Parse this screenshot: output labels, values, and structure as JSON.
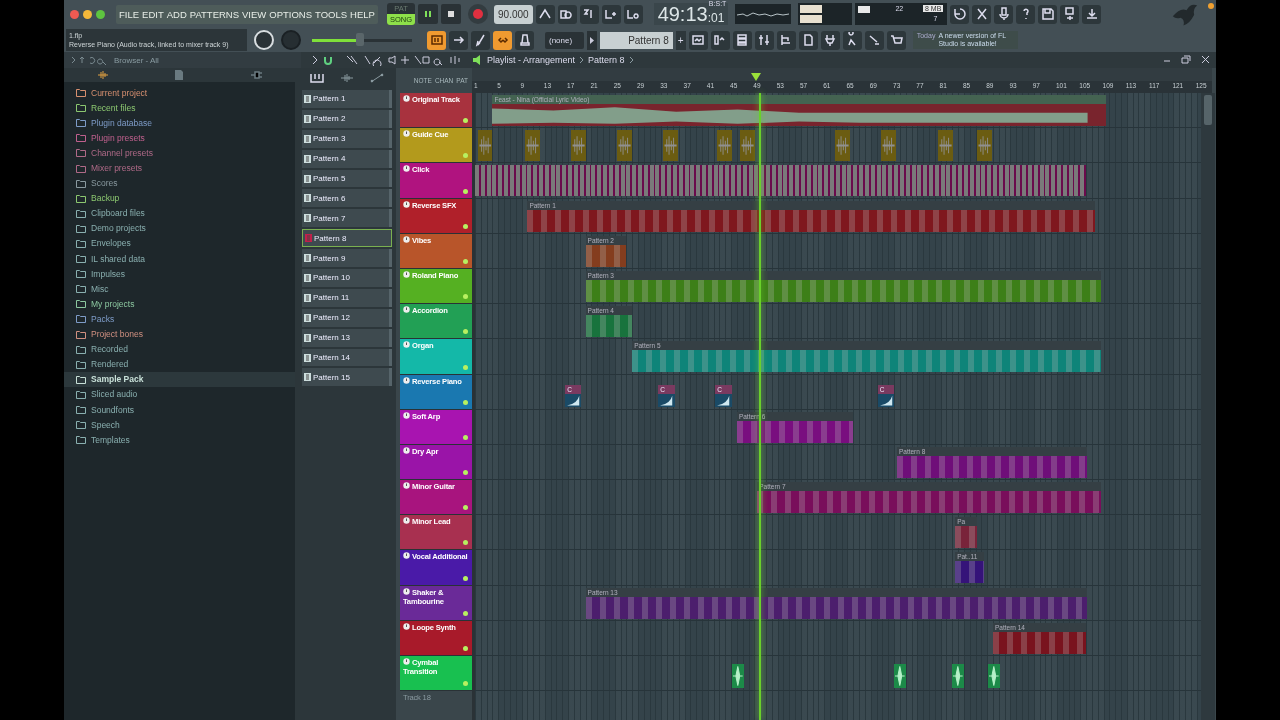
{
  "menu": [
    "FILE",
    "EDIT",
    "ADD",
    "PATTERNS",
    "VIEW",
    "OPTIONS",
    "TOOLS",
    "HELP"
  ],
  "transport": {
    "modes": [
      {
        "label": "PAT",
        "selected": false
      },
      {
        "label": "SONG",
        "selected": true
      }
    ],
    "playing": true,
    "tempo": "90.000",
    "time_main": "49:13",
    "time_sub": ":01",
    "time_format": "B:S:T"
  },
  "monitor": {
    "cpu": "22",
    "memory": "8 MB",
    "polyphony": "7"
  },
  "hint_panel": {
    "file": "1.flp",
    "message": "Reverse Piano (Audio track, linked to mixer track 9)"
  },
  "master_volume": {
    "level": 0.48
  },
  "toggles": [
    {
      "on": true
    },
    {
      "on": false
    },
    {
      "on": false
    },
    {
      "on": true
    },
    {
      "on": false
    }
  ],
  "snap": "(none)",
  "pattern_selector": "Pattern 8",
  "add_label": "+",
  "news": {
    "day": "Today",
    "text": "A newer version of FL Studio is available!"
  },
  "browser": {
    "title": "Browser - All",
    "items": [
      {
        "label": "Current project",
        "color": "#d89070",
        "selected": false
      },
      {
        "label": "Recent files",
        "color": "#8cc870",
        "selected": false
      },
      {
        "label": "Plugin database",
        "color": "#7e9cc8",
        "selected": false
      },
      {
        "label": "Plugin presets",
        "color": "#c0608e",
        "selected": false
      },
      {
        "label": "Channel presets",
        "color": "#b06a88",
        "selected": false
      },
      {
        "label": "Mixer presets",
        "color": "#b06a88",
        "selected": false
      },
      {
        "label": "Scores",
        "color": "#8a9aa0",
        "selected": false
      },
      {
        "label": "Backup",
        "color": "#8cc870",
        "selected": false
      },
      {
        "label": "Clipboard files",
        "color": "#8ab0b0",
        "selected": false
      },
      {
        "label": "Demo projects",
        "color": "#8ab0b0",
        "selected": false
      },
      {
        "label": "Envelopes",
        "color": "#8ab0b0",
        "selected": false
      },
      {
        "label": "IL shared data",
        "color": "#8ab0b0",
        "selected": false
      },
      {
        "label": "Impulses",
        "color": "#8ab0b0",
        "selected": false
      },
      {
        "label": "Misc",
        "color": "#8ab0b0",
        "selected": false
      },
      {
        "label": "My projects",
        "color": "#8cc8a0",
        "selected": false
      },
      {
        "label": "Packs",
        "color": "#7e9cc8",
        "selected": false
      },
      {
        "label": "Project bones",
        "color": "#d09080",
        "selected": false
      },
      {
        "label": "Recorded",
        "color": "#8ab0b0",
        "selected": false
      },
      {
        "label": "Rendered",
        "color": "#8ab0b0",
        "selected": false
      },
      {
        "label": "Sample Pack",
        "color": "#c8e0d8",
        "selected": true
      },
      {
        "label": "Sliced audio",
        "color": "#8ab0b0",
        "selected": false
      },
      {
        "label": "Soundfonts",
        "color": "#8ab0b0",
        "selected": false
      },
      {
        "label": "Speech",
        "color": "#8ab0b0",
        "selected": false
      },
      {
        "label": "Templates",
        "color": "#8ab0b0",
        "selected": false
      }
    ]
  },
  "playlist": {
    "title": "Playlist - Arrangement",
    "current_pattern": "Pattern 8",
    "column_heads": [
      "NOTE",
      "CHAN",
      "PAT"
    ],
    "patterns": [
      {
        "label": "Pattern 1",
        "selected": false
      },
      {
        "label": "Pattern 2",
        "selected": false
      },
      {
        "label": "Pattern 3",
        "selected": false
      },
      {
        "label": "Pattern 4",
        "selected": false
      },
      {
        "label": "Pattern 5",
        "selected": false
      },
      {
        "label": "Pattern 6",
        "selected": false
      },
      {
        "label": "Pattern 7",
        "selected": false
      },
      {
        "label": "Pattern 8",
        "selected": true
      },
      {
        "label": "Pattern 9",
        "selected": false
      },
      {
        "label": "Pattern 10",
        "selected": false
      },
      {
        "label": "Pattern 11",
        "selected": false
      },
      {
        "label": "Pattern 12",
        "selected": false
      },
      {
        "label": "Pattern 13",
        "selected": false
      },
      {
        "label": "Pattern 14",
        "selected": false
      },
      {
        "label": "Pattern 15",
        "selected": false
      }
    ],
    "ruler": [
      "1",
      "5",
      "9",
      "13",
      "17",
      "21",
      "25",
      "29",
      "33",
      "37",
      "41",
      "45",
      "49",
      "53",
      "57",
      "61",
      "65",
      "69",
      "73",
      "77",
      "81",
      "85",
      "89",
      "93",
      "97",
      "101",
      "105",
      "109",
      "113",
      "117",
      "121",
      "125"
    ],
    "tracks": [
      {
        "name": "Original Track",
        "color": "#a8323e",
        "active": true,
        "clips": [
          {
            "kind": "audio",
            "label": "Feast - Nina (Official Lyric Video)"
          }
        ]
      },
      {
        "name": "Guide Cue",
        "color": "#b39a1c",
        "active": true,
        "clips": [
          {
            "kind": "cue"
          },
          {
            "kind": "cue"
          },
          {
            "kind": "cue"
          },
          {
            "kind": "cue"
          },
          {
            "kind": "cue"
          },
          {
            "kind": "cue"
          },
          {
            "kind": "cue"
          },
          {
            "kind": "cue"
          },
          {
            "kind": "cue"
          },
          {
            "kind": "cue"
          },
          {
            "kind": "cue"
          }
        ]
      },
      {
        "name": "Click",
        "color": "#b0137f",
        "active": true,
        "clips": [
          {
            "kind": "click"
          }
        ]
      },
      {
        "name": "Reverse SFX",
        "color": "#b0202a",
        "active": true,
        "clips": [
          {
            "kind": "pattern",
            "label": "Pattern 1"
          }
        ]
      },
      {
        "name": "Vibes",
        "color": "#b8552a",
        "active": true,
        "clips": [
          {
            "kind": "pattern",
            "label": "Pattern 2"
          }
        ]
      },
      {
        "name": "Roland Piano",
        "color": "#55b022",
        "active": true,
        "clips": [
          {
            "kind": "pattern",
            "label": "Pattern 3"
          }
        ]
      },
      {
        "name": "Accordion",
        "color": "#22a055",
        "active": true,
        "clips": [
          {
            "kind": "pattern",
            "label": "Pattern 4"
          }
        ]
      },
      {
        "name": "Organ",
        "color": "#14b8a8",
        "active": true,
        "clips": [
          {
            "kind": "pattern",
            "label": "Pattern 5"
          }
        ]
      },
      {
        "name": "Reverse Piano",
        "color": "#1a78b0",
        "active": true,
        "clips": [
          {
            "kind": "sample",
            "label": "C"
          },
          {
            "kind": "sample",
            "label": "C"
          },
          {
            "kind": "sample",
            "label": "C"
          },
          {
            "kind": "sample",
            "label": "C"
          }
        ]
      },
      {
        "name": "Soft Arp",
        "color": "#a814b0",
        "active": true,
        "clips": [
          {
            "kind": "pattern",
            "label": "Pattern 6"
          }
        ]
      },
      {
        "name": "Dry Apr",
        "color": "#9a14a8",
        "active": true,
        "clips": [
          {
            "kind": "pattern",
            "label": "Pattern 8"
          }
        ]
      },
      {
        "name": "Minor Guitar",
        "color": "#a8147e",
        "active": true,
        "clips": [
          {
            "kind": "pattern",
            "label": "Pattern 7"
          }
        ]
      },
      {
        "name": "Minor Lead",
        "color": "#a83050",
        "active": true,
        "clips": [
          {
            "kind": "pattern",
            "label": "Pa"
          }
        ]
      },
      {
        "name": "Vocal Additional",
        "color": "#4a1aa8",
        "active": true,
        "clips": [
          {
            "kind": "pattern",
            "label": "Pat..11"
          }
        ]
      },
      {
        "name": "Shaker & Tambourine",
        "color": "#6a2a98",
        "active": true,
        "clips": [
          {
            "kind": "pattern",
            "label": "Pattern 13"
          }
        ]
      },
      {
        "name": "Loope Synth",
        "color": "#a81a2a",
        "active": true,
        "clips": [
          {
            "kind": "pattern",
            "label": "Pattern 14"
          }
        ]
      },
      {
        "name": "Cymbal Transition",
        "color": "#18c050",
        "active": true,
        "clips": [
          {
            "kind": "hit"
          },
          {
            "kind": "hit"
          },
          {
            "kind": "hit"
          },
          {
            "kind": "hit"
          }
        ]
      }
    ],
    "empty_track": "Track 18"
  }
}
